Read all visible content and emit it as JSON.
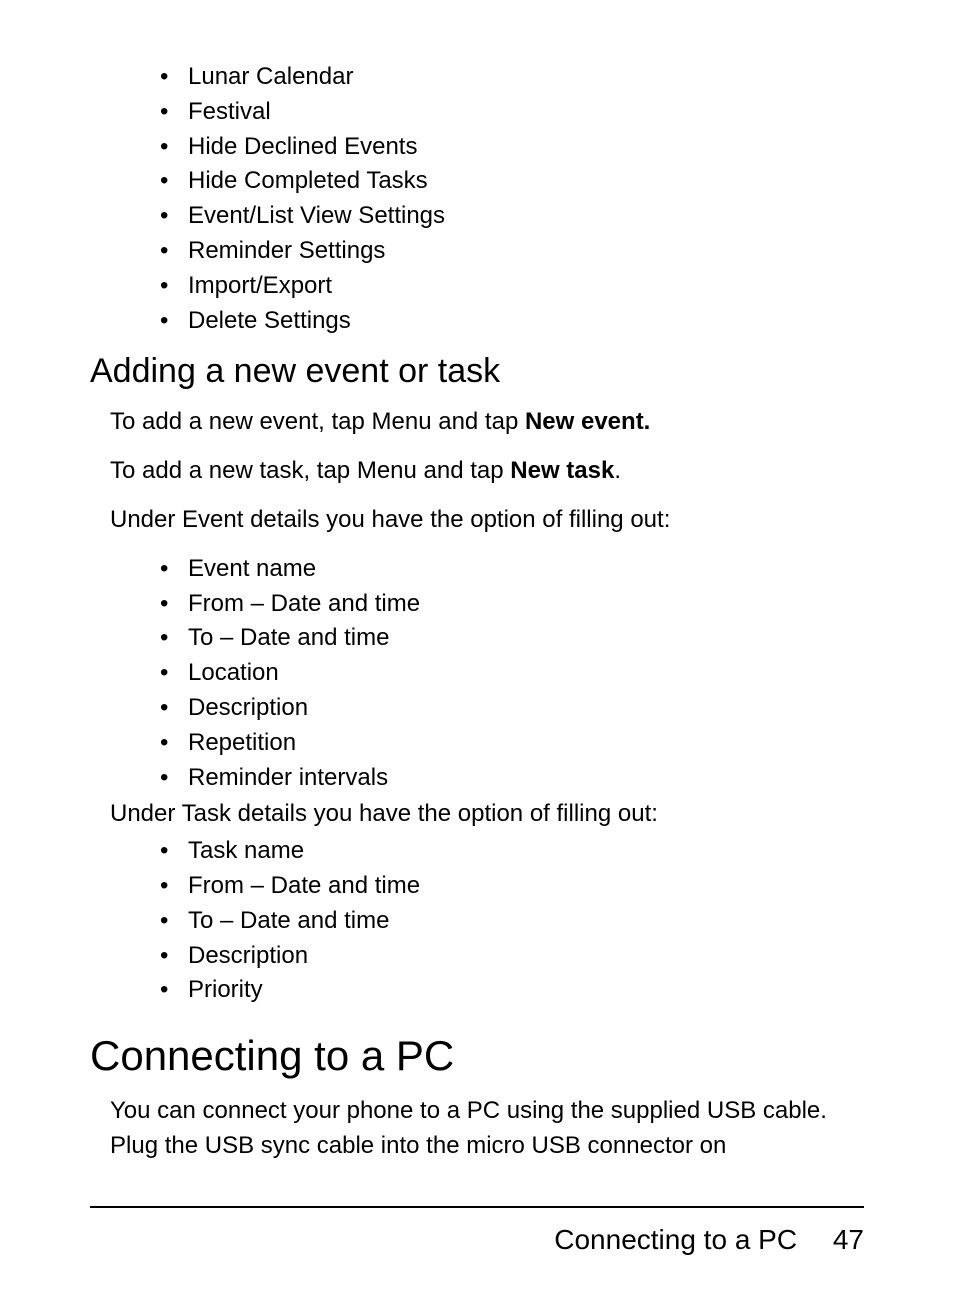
{
  "list_top": [
    "Lunar Calendar",
    "Festival",
    "Hide Declined Events",
    "Hide Completed Tasks",
    "Event/List View Settings",
    "Reminder Settings",
    "Import/Export",
    "Delete Settings"
  ],
  "subheading": "Adding a new event or task",
  "para_event_pre": "To add a new event, tap Menu and tap ",
  "para_event_bold": "New event.",
  "para_task_pre": "To add a new task, tap Menu and tap ",
  "para_task_bold": "New task",
  "para_task_post": ".",
  "para_eventdetails": "Under Event details you have the option of filling out:",
  "list_event": [
    "Event name",
    "From – Date and time",
    "To – Date and time",
    "Location",
    "Description",
    "Repetition",
    "Reminder intervals"
  ],
  "para_taskdetails": "Under Task details you have the option of filling out:",
  "list_task": [
    "Task name",
    "From – Date and time",
    "To – Date and time",
    "Description",
    "Priority"
  ],
  "mainheading": "Connecting to a PC",
  "para_pc": "You can connect your phone to a PC using the supplied USB cable. Plug the USB sync cable into the micro USB connector on",
  "footer_title": "Connecting to a PC",
  "footer_page": "47"
}
